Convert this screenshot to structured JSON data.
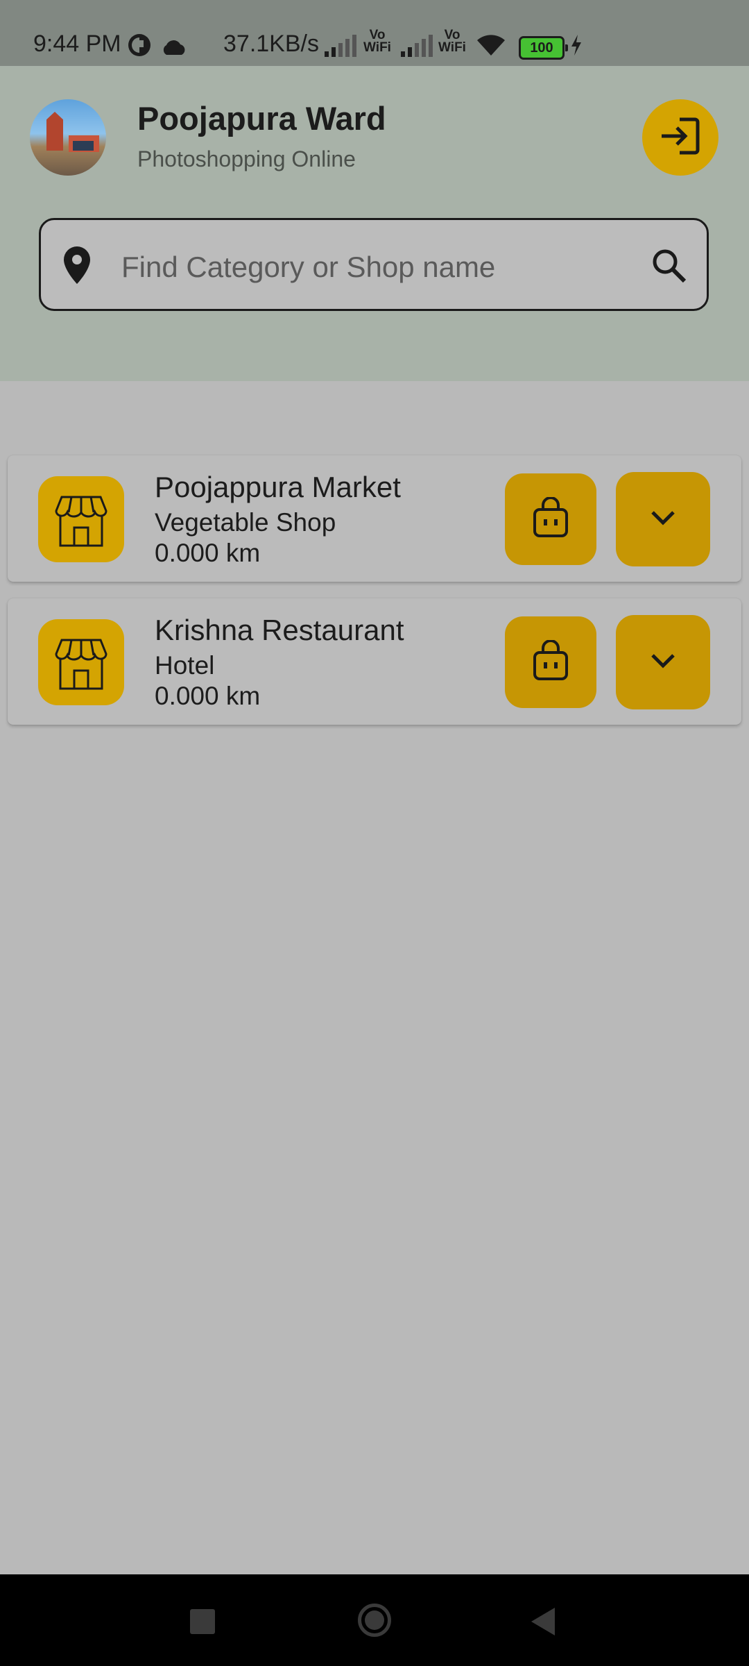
{
  "status_bar": {
    "time": "9:44 PM",
    "net_speed": "37.1KB/s",
    "vowifi_1": "Vo WiFi",
    "vowifi_2": "Vo WiFi",
    "battery": "100",
    "icons": [
      "app-badge-icon",
      "cloud-icon",
      "signal-icon",
      "signal-icon",
      "wifi-icon",
      "battery-icon",
      "charging-icon"
    ]
  },
  "header": {
    "title": "Poojapura Ward",
    "subtitle": "Photoshopping Online",
    "login_icon": "login-icon"
  },
  "search": {
    "placeholder": "Find Category or Shop name",
    "location_icon": "location-pin-icon",
    "search_icon": "search-icon"
  },
  "shops": [
    {
      "name": "Poojappura Market",
      "category": "Vegetable Shop",
      "distance": "0.000 km"
    },
    {
      "name": "Krishna Restaurant",
      "category": "Hotel",
      "distance": "0.000 km"
    }
  ],
  "colors": {
    "accent": "#d4a402",
    "header_bg": "#a8b2a8",
    "page_bg": "#b9b9b9",
    "status_bg": "#818882"
  }
}
